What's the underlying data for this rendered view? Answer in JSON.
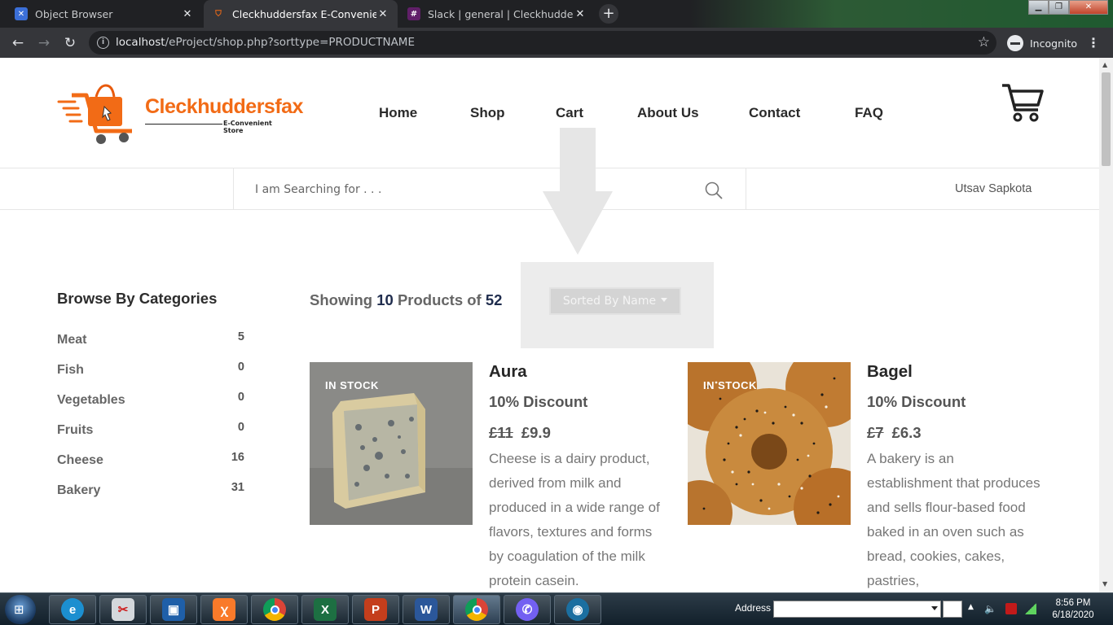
{
  "browser": {
    "tabs": [
      {
        "title": "Object Browser",
        "icon": "object-browser-icon",
        "active": false
      },
      {
        "title": "Cleckhuddersfax E-Convenient St",
        "icon": "store-favicon-icon",
        "active": true
      },
      {
        "title": "Slack | general | Cleckhuddersfax",
        "icon": "slack-icon",
        "active": false
      }
    ],
    "new_tab_label": "+",
    "url_host": "localhost",
    "url_path": "/eProject/shop.php?sorttype=PRODUCTNAME",
    "incognito_label": "Incognito"
  },
  "site": {
    "brand": "Cleckhuddersfax",
    "tagline": "E-Convenient Store",
    "nav": [
      "Home",
      "Shop",
      "Cart",
      "About Us",
      "Contact",
      "FAQ"
    ],
    "search_placeholder": "I am Searching for . . .",
    "username": "Utsav Sapkota",
    "sort_label": "Sorted By Name"
  },
  "sidebar": {
    "title": "Browse By Categories",
    "categories": [
      {
        "name": "Meat",
        "count": "5"
      },
      {
        "name": "Fish",
        "count": "0"
      },
      {
        "name": "Vegetables",
        "count": "0"
      },
      {
        "name": "Fruits",
        "count": "0"
      },
      {
        "name": "Cheese",
        "count": "16"
      },
      {
        "name": "Bakery",
        "count": "31"
      }
    ]
  },
  "listing": {
    "showing_prefix": "Showing",
    "shown_count": "10",
    "middle_text": "Products of",
    "total_count": "52"
  },
  "products": [
    {
      "badge": "IN STOCK",
      "name": "Aura",
      "discount": "10% Discount",
      "old_price": "£11",
      "new_price": "£9.9",
      "description": "Cheese is a dairy product, derived from milk and produced in a wide range of flavors, textures and forms by coagulation of the milk protein casein."
    },
    {
      "badge": "IN STOCK",
      "name": "Bagel",
      "discount": "10% Discount",
      "old_price": "£7",
      "new_price": "£6.3",
      "description": "A bakery is an establishment that produces and sells flour-based food baked in an oven such as bread, cookies, cakes, pastries,"
    }
  ],
  "taskbar": {
    "apps": [
      "ie-icon",
      "snipping-tool-icon",
      "virtualbox-icon",
      "xampp-icon",
      "chrome-icon",
      "excel-icon",
      "powerpoint-icon",
      "word-icon",
      "chrome-active-icon",
      "viber-icon",
      "camtasia-icon"
    ],
    "address_label": "Address",
    "time": "8:56 PM",
    "date": "6/18/2020"
  },
  "colors": {
    "brand_orange": "#f26b16",
    "heading_dark": "#2d2d2d",
    "count_navy": "#1f2c4d"
  }
}
